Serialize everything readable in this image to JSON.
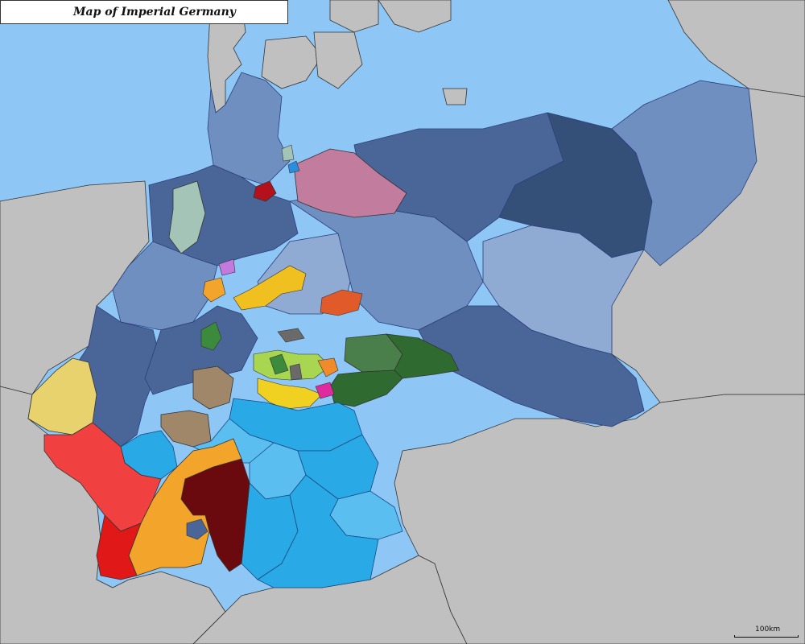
{
  "title": "Map of Imperial Germany",
  "scale_label": "100km",
  "colors": {
    "sea": "#8ec6f5",
    "foreign_land": "#c0c0c0",
    "prussia_light": "#8faad3",
    "prussia_mid": "#6f8fc0",
    "prussia_dark": "#4a6698",
    "prussia_darkest": "#344f78",
    "mecklenburg_schwerin": "#c27c9e",
    "hamburg": "#b3121c",
    "oldenburg": "#a3c4b6",
    "saxony_light": "#4a7e4b",
    "saxony_dark": "#2f6a30",
    "thuringia_yellow": "#f0d020",
    "lime": "#a8d650",
    "anhalt": "#e05a2a",
    "hesse": "#a0876a",
    "bavaria": "#29a9e6",
    "bavaria_light": "#5bbef0",
    "wurttemberg": "#6b0a0e",
    "baden_orange": "#f2a52a",
    "alsace_lorraine_red": "#f04040",
    "alsace_lorraine_dark": "#e01818",
    "luxembourg": "#e8d26e",
    "magenta": "#e02ba0",
    "orange": "#f08a2a",
    "purple": "#c47adc",
    "green_waldeck": "#3c8a3c",
    "grey_enclave": "#6a6a6a"
  }
}
